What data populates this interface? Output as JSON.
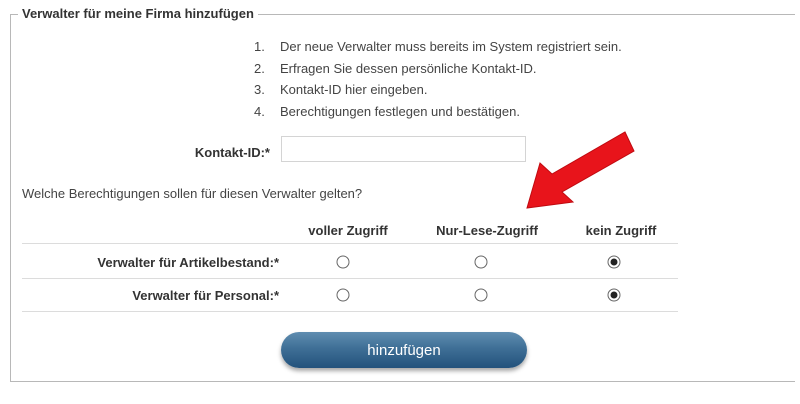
{
  "form": {
    "legend": "Verwalter für meine Firma hinzufügen",
    "steps": [
      {
        "num": "1.",
        "text": "Der neue Verwalter muss bereits im System registriert sein."
      },
      {
        "num": "2.",
        "text": "Erfragen Sie dessen persönliche Kontakt-ID."
      },
      {
        "num": "3.",
        "text": "Kontakt-ID hier eingeben."
      },
      {
        "num": "4.",
        "text": "Berechtigungen festlegen und bestätigen."
      }
    ],
    "contact_label": "Kontakt-ID:*",
    "contact_value": "",
    "question": "Welche Berechtigungen sollen für diesen Verwalter gelten?",
    "columns": [
      "voller Zugriff",
      "Nur-Lese-Zugriff",
      "kein Zugriff"
    ],
    "rows": [
      {
        "label": "Verwalter für Artikelbestand:*",
        "selected": "kein Zugriff"
      },
      {
        "label": "Verwalter für Personal:*",
        "selected": "kein Zugriff"
      }
    ],
    "submit_label": "hinzufügen"
  },
  "colors": {
    "button": "#3f6f96",
    "arrow": "#e8141b",
    "border": "#b8b8b8"
  },
  "icons": {
    "annotation": "red-arrow-icon"
  }
}
